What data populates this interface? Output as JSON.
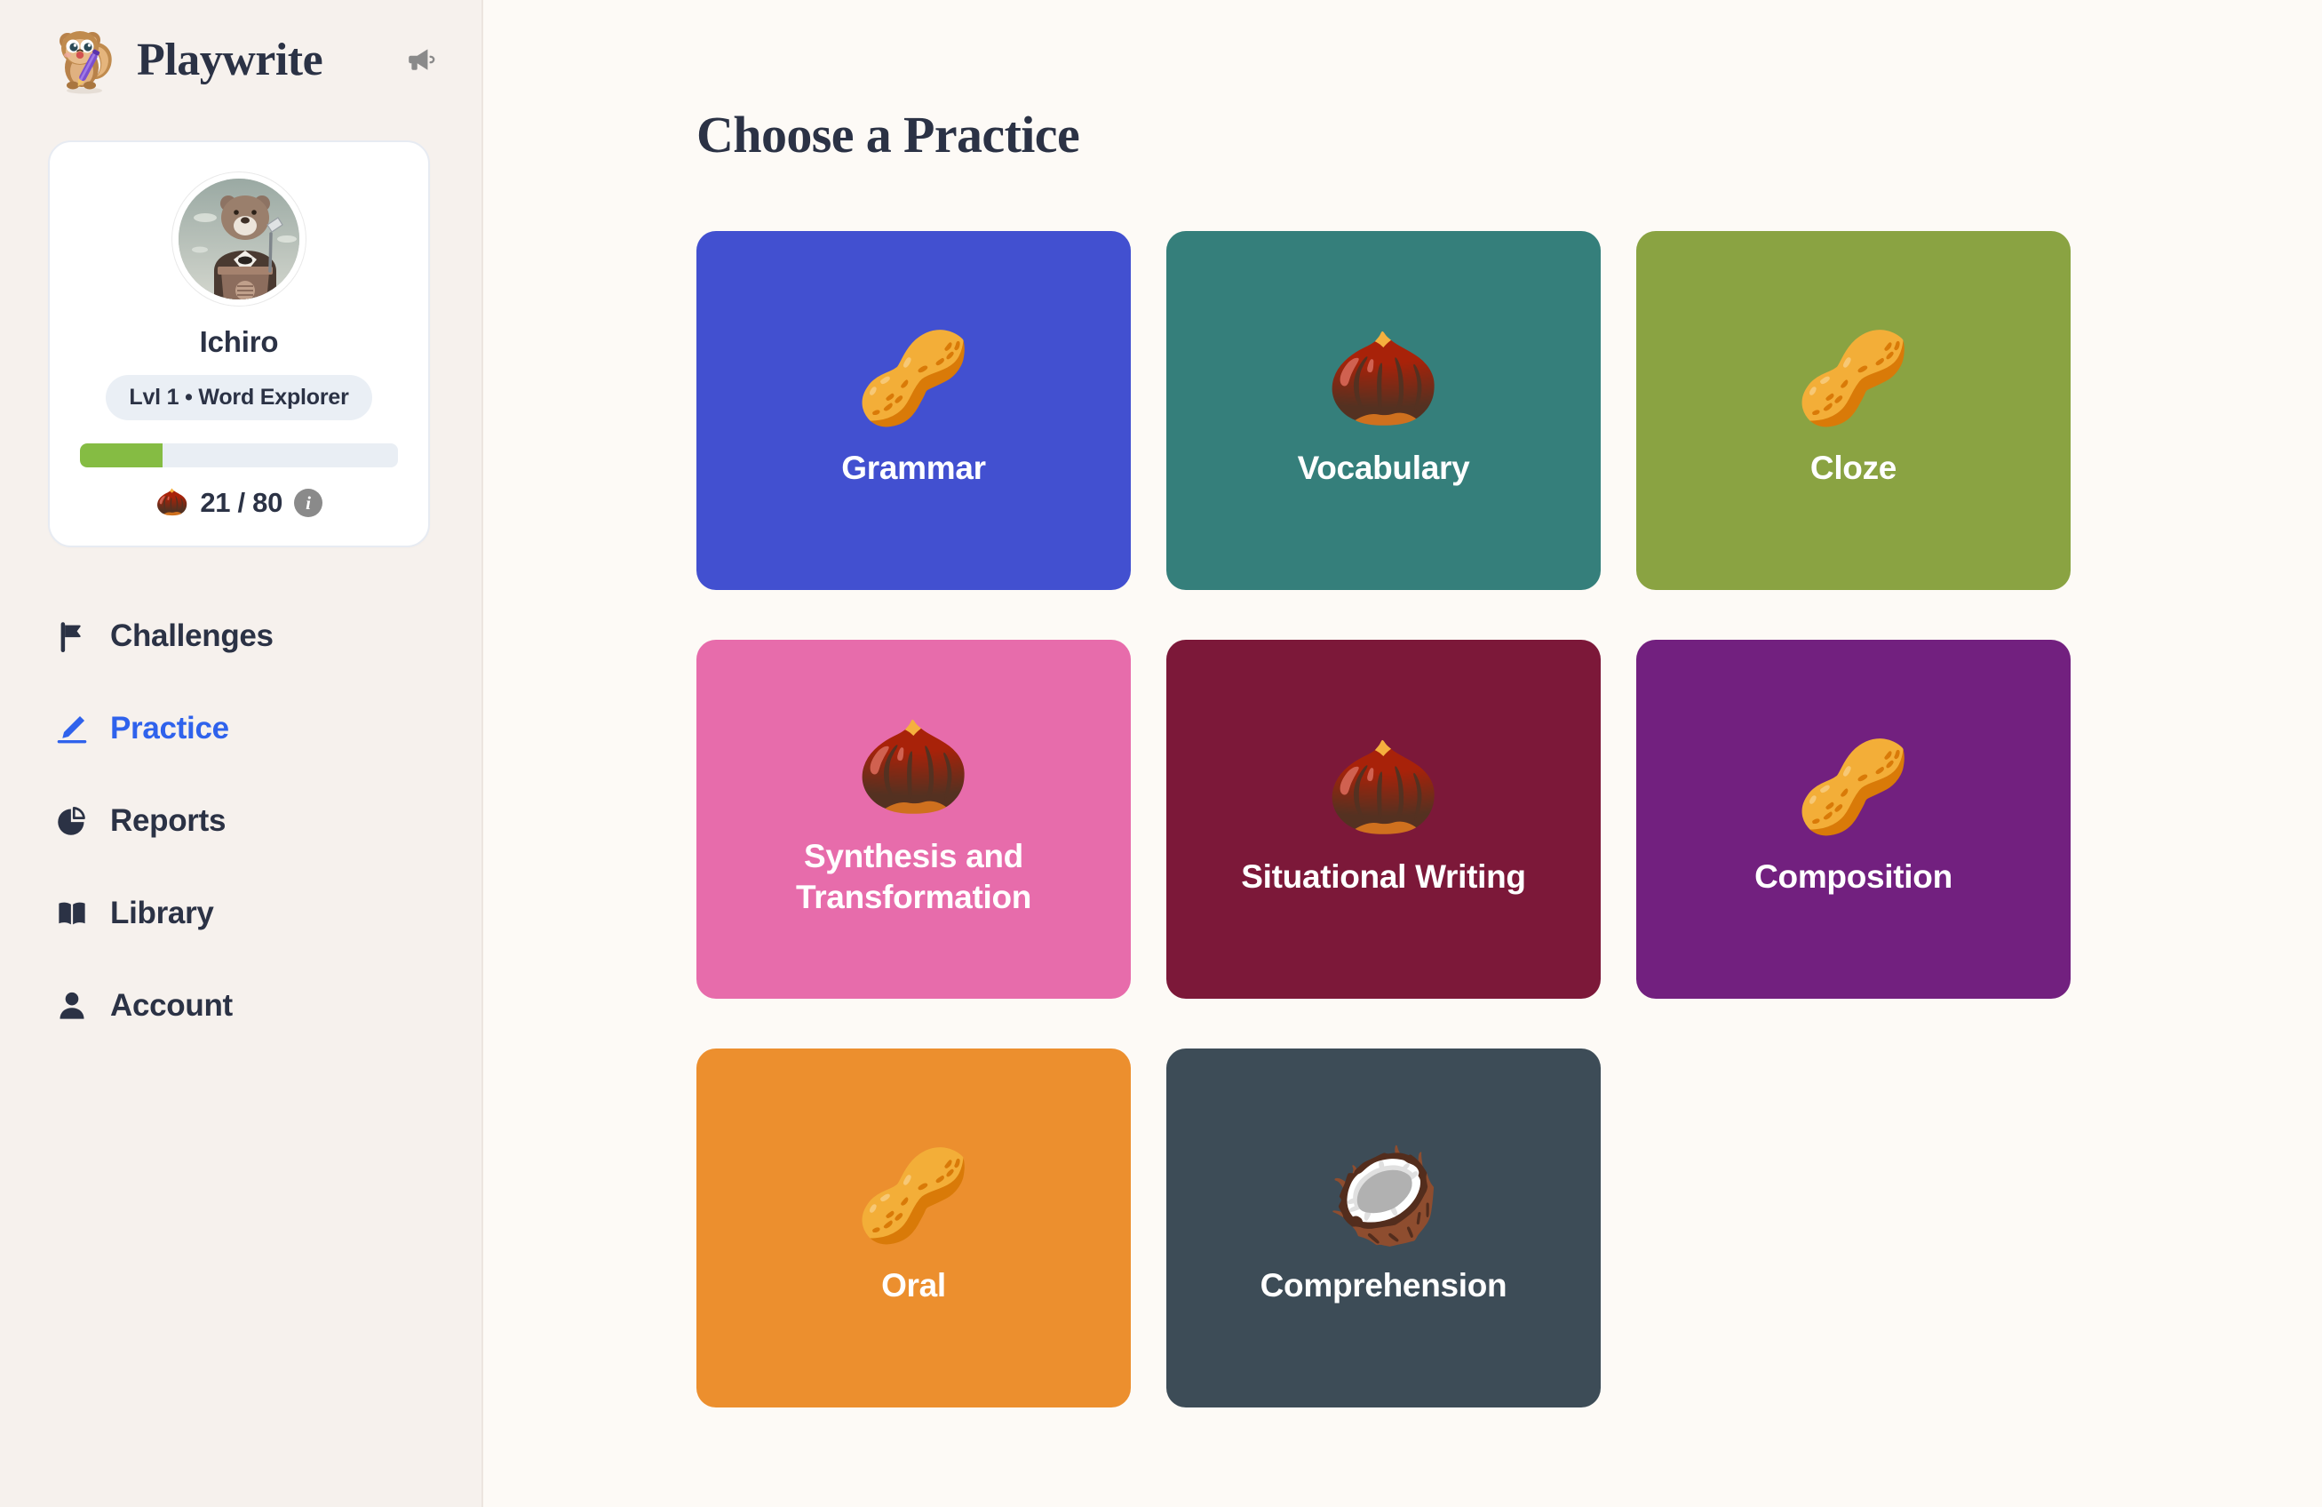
{
  "app": {
    "brand_name": "Playwrite",
    "brand_logo_icon": "squirrel-with-pen-logo",
    "announcements_icon": "megaphone-icon"
  },
  "profile": {
    "avatar_icon": "bear-at-podium-avatar",
    "username": "Ichiro",
    "level_pill": "Lvl 1 • Word Explorer",
    "xp_percent": 26,
    "xp_icon": "acorn-icon",
    "xp_text": "21 / 80",
    "info_icon": "info-icon",
    "info_label": "i"
  },
  "sidebar": {
    "items": [
      {
        "label": "Challenges",
        "icon": "flag-icon",
        "active": false
      },
      {
        "label": "Practice",
        "icon": "pencil-icon",
        "active": true
      },
      {
        "label": "Reports",
        "icon": "pie-chart-icon",
        "active": false
      },
      {
        "label": "Library",
        "icon": "book-icon",
        "active": false
      },
      {
        "label": "Account",
        "icon": "person-icon",
        "active": false
      }
    ]
  },
  "main": {
    "page_title": "Choose a Practice",
    "cards": [
      {
        "label": "Grammar",
        "emoji": "🥜",
        "emoji_name": "cashew-nuts-icon",
        "color": "#4250d0"
      },
      {
        "label": "Vocabulary",
        "emoji": "🌰",
        "emoji_name": "cracked-nut-icon",
        "color": "#357f7b"
      },
      {
        "label": "Cloze",
        "emoji": "🥜",
        "emoji_name": "pecan-nuts-icon",
        "color": "#8aa342"
      },
      {
        "label": "Synthesis and Transformation",
        "emoji": "🌰",
        "emoji_name": "acorns-icon",
        "color": "#e76cab"
      },
      {
        "label": "Situational Writing",
        "emoji": "🌰",
        "emoji_name": "walnut-icon",
        "color": "#7c1839"
      },
      {
        "label": "Composition",
        "emoji": "🥜",
        "emoji_name": "pistachios-icon",
        "color": "#72207f"
      },
      {
        "label": "Oral",
        "emoji": "🥜",
        "emoji_name": "peanuts-icon",
        "color": "#ec8f2e"
      },
      {
        "label": "Comprehension",
        "emoji": "🥥",
        "emoji_name": "coconut-icon",
        "color": "#3d4c57"
      }
    ]
  },
  "colors": {
    "accent": "#2f62ec",
    "xp_fill": "#85bc43",
    "sidebar_bg": "#f6f1ed",
    "main_bg": "#fdfaf6",
    "text": "#2b3245"
  }
}
